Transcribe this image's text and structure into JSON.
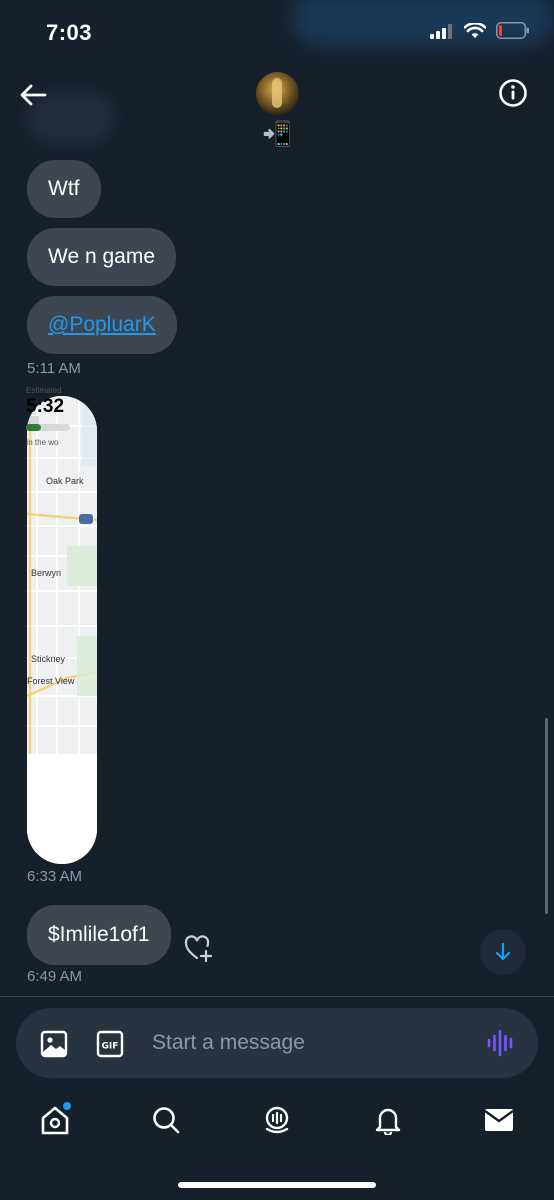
{
  "status_bar": {
    "time": "7:03",
    "icons": [
      "signal-icon",
      "wifi-icon",
      "battery-icon"
    ]
  },
  "header": {
    "back_icon": "arrow-left-icon",
    "avatar_name": "avatar",
    "emoji": "📲",
    "info_icon": "info-icon"
  },
  "messages": [
    {
      "text": "Wtf"
    },
    {
      "text": "We n game"
    },
    {
      "text": "@PopluarK",
      "is_link": true
    }
  ],
  "timestamps": {
    "first": "5:11 AM",
    "second": "6:33 AM",
    "third": "6:49 AM"
  },
  "map_card": {
    "labels": [
      "Oak Park",
      "Berwyn",
      "Stickney",
      "Forest View"
    ],
    "estimated_label": "Estimated",
    "eta": "5:32",
    "progress": 0.35,
    "footer": "In the wo"
  },
  "last_message": {
    "text": "$Imlile1of1"
  },
  "composer": {
    "placeholder": "Start a message",
    "image_icon": "image-icon",
    "gif_icon": "gif-icon",
    "voice_icon": "voice-icon"
  },
  "tabs": [
    {
      "name": "home",
      "icon": "home-icon"
    },
    {
      "name": "search",
      "icon": "search-icon"
    },
    {
      "name": "spaces",
      "icon": "spaces-icon"
    },
    {
      "name": "notifications",
      "icon": "bell-icon"
    },
    {
      "name": "messages",
      "icon": "mail-icon"
    }
  ],
  "colors": {
    "background": "#15202b",
    "bubble": "#3d4651",
    "accent": "#1d9bf0",
    "voice": "#7856ff"
  }
}
